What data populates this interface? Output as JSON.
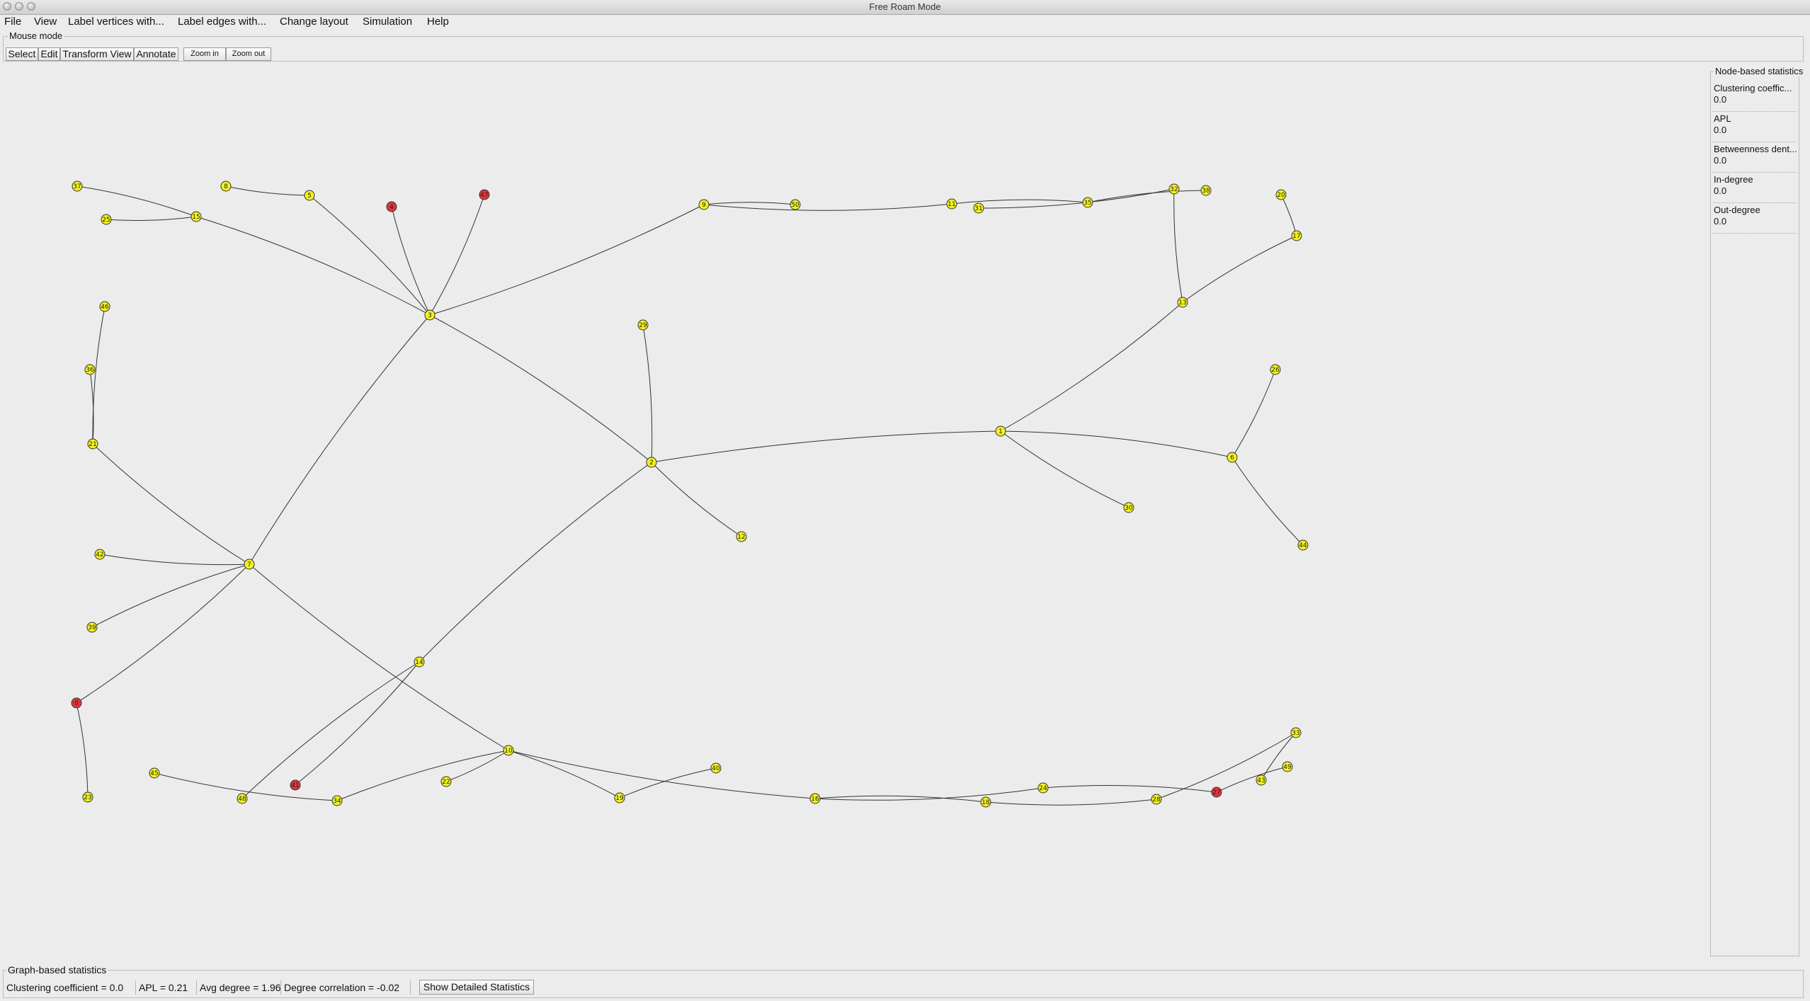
{
  "window": {
    "title": "Free Roam Mode"
  },
  "menu": [
    "File",
    "View",
    "Label vertices with...",
    "Label edges with...",
    "Change layout",
    "Simulation",
    "Help"
  ],
  "mouse_mode": {
    "legend": "Mouse mode",
    "buttons": [
      "Select",
      "Edit",
      "Transform View",
      "Annotate"
    ],
    "zoom_buttons": [
      "Zoom in",
      "Zoom out"
    ]
  },
  "graph": {
    "colors": {
      "normal": "#f2f21e",
      "highlighted": "#e0353b",
      "edge": "#333333"
    },
    "vertices": [
      {
        "id": "37",
        "color": "yellow"
      },
      {
        "id": "8",
        "color": "yellow"
      },
      {
        "id": "5",
        "color": "yellow"
      },
      {
        "id": "4",
        "color": "red"
      },
      {
        "id": "47",
        "color": "red"
      },
      {
        "id": "15",
        "color": "yellow"
      },
      {
        "id": "25",
        "color": "yellow"
      },
      {
        "id": "3",
        "color": "yellow"
      },
      {
        "id": "9",
        "color": "yellow"
      },
      {
        "id": "50",
        "color": "yellow"
      },
      {
        "id": "11",
        "color": "yellow"
      },
      {
        "id": "31",
        "color": "yellow"
      },
      {
        "id": "35",
        "color": "yellow"
      },
      {
        "id": "32",
        "color": "yellow"
      },
      {
        "id": "38",
        "color": "yellow"
      },
      {
        "id": "20",
        "color": "yellow"
      },
      {
        "id": "17",
        "color": "yellow"
      },
      {
        "id": "13",
        "color": "yellow"
      },
      {
        "id": "46",
        "color": "yellow"
      },
      {
        "id": "36",
        "color": "yellow"
      },
      {
        "id": "21",
        "color": "yellow"
      },
      {
        "id": "29",
        "color": "yellow"
      },
      {
        "id": "2",
        "color": "yellow"
      },
      {
        "id": "12",
        "color": "yellow"
      },
      {
        "id": "1",
        "color": "yellow"
      },
      {
        "id": "26",
        "color": "yellow"
      },
      {
        "id": "6",
        "color": "yellow"
      },
      {
        "id": "30",
        "color": "yellow"
      },
      {
        "id": "44",
        "color": "yellow"
      },
      {
        "id": "7",
        "color": "yellow"
      },
      {
        "id": "42",
        "color": "yellow"
      },
      {
        "id": "39",
        "color": "yellow"
      },
      {
        "id": "14",
        "color": "yellow"
      },
      {
        "id": "0",
        "color": "red"
      },
      {
        "id": "23",
        "color": "yellow"
      },
      {
        "id": "45",
        "color": "yellow"
      },
      {
        "id": "48",
        "color": "yellow"
      },
      {
        "id": "41",
        "color": "red"
      },
      {
        "id": "34",
        "color": "yellow"
      },
      {
        "id": "22",
        "color": "yellow"
      },
      {
        "id": "10",
        "color": "yellow"
      },
      {
        "id": "19",
        "color": "yellow"
      },
      {
        "id": "40",
        "color": "yellow"
      },
      {
        "id": "16",
        "color": "yellow"
      },
      {
        "id": "18",
        "color": "yellow"
      },
      {
        "id": "24",
        "color": "yellow"
      },
      {
        "id": "28",
        "color": "yellow"
      },
      {
        "id": "27",
        "color": "red"
      },
      {
        "id": "33",
        "color": "yellow"
      },
      {
        "id": "49",
        "color": "yellow"
      },
      {
        "id": "43",
        "color": "yellow"
      }
    ],
    "edges": [
      [
        "37",
        "15"
      ],
      [
        "25",
        "15"
      ],
      [
        "15",
        "3"
      ],
      [
        "8",
        "5"
      ],
      [
        "5",
        "3"
      ],
      [
        "4",
        "3"
      ],
      [
        "47",
        "3"
      ],
      [
        "3",
        "9"
      ],
      [
        "3",
        "2"
      ],
      [
        "3",
        "7"
      ],
      [
        "9",
        "50"
      ],
      [
        "9",
        "11"
      ],
      [
        "11",
        "35"
      ],
      [
        "31",
        "32"
      ],
      [
        "35",
        "38"
      ],
      [
        "32",
        "13"
      ],
      [
        "20",
        "17"
      ],
      [
        "17",
        "13"
      ],
      [
        "13",
        "1"
      ],
      [
        "46",
        "21"
      ],
      [
        "36",
        "21"
      ],
      [
        "21",
        "7"
      ],
      [
        "29",
        "2"
      ],
      [
        "2",
        "12"
      ],
      [
        "2",
        "1"
      ],
      [
        "2",
        "14"
      ],
      [
        "1",
        "6"
      ],
      [
        "1",
        "30"
      ],
      [
        "26",
        "6"
      ],
      [
        "6",
        "44"
      ],
      [
        "7",
        "42"
      ],
      [
        "7",
        "39"
      ],
      [
        "7",
        "0"
      ],
      [
        "7",
        "10"
      ],
      [
        "0",
        "23"
      ],
      [
        "14",
        "48"
      ],
      [
        "14",
        "41"
      ],
      [
        "45",
        "34"
      ],
      [
        "34",
        "10"
      ],
      [
        "22",
        "10"
      ],
      [
        "10",
        "19"
      ],
      [
        "10",
        "16"
      ],
      [
        "19",
        "40"
      ],
      [
        "16",
        "24"
      ],
      [
        "16",
        "18"
      ],
      [
        "18",
        "28"
      ],
      [
        "24",
        "27"
      ],
      [
        "28",
        "33"
      ],
      [
        "27",
        "49"
      ],
      [
        "33",
        "43"
      ]
    ]
  },
  "node_stats": {
    "title": "Node-based statistics",
    "items": [
      {
        "label": "Clustering coeffic...",
        "value": "0.0"
      },
      {
        "label": "APL",
        "value": "0.0"
      },
      {
        "label": "Betweenness dent...",
        "value": "0.0"
      },
      {
        "label": "In-degree",
        "value": "0.0"
      },
      {
        "label": "Out-degree",
        "value": "0.0"
      }
    ]
  },
  "graph_stats": {
    "title": "Graph-based statistics",
    "clustering": "Clustering coefficient = 0.0",
    "apl": "APL = 0.21",
    "avg_degree": "Avg degree = 1.96",
    "degree_corr": "Degree correlation = -0.02",
    "details_button": "Show Detailed Statistics"
  }
}
